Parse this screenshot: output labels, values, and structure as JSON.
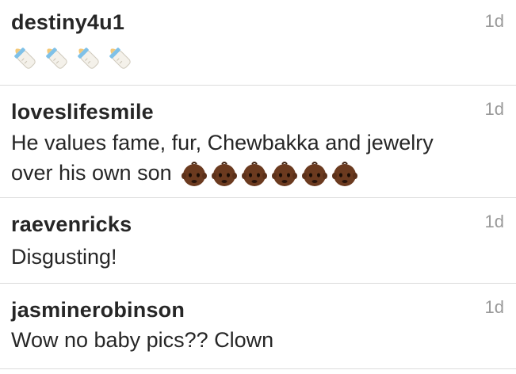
{
  "comments": [
    {
      "username": "destiny4u1",
      "time": "1d",
      "text": "",
      "emoji_name": "baby-bottle-icon",
      "emoji_count": 4
    },
    {
      "username": "loveslifesmile",
      "time": "1d",
      "text_line1": "He values fame, fur, Chewbakka and jewelry",
      "text_line2": "over his own son",
      "emoji_name": "baby-face-icon",
      "emoji_count": 6
    },
    {
      "username": "raevenricks",
      "time": "1d",
      "text": "Disgusting!"
    },
    {
      "username": "jasminerobinson",
      "time": "1d",
      "text": "Wow no baby pics?? Clown"
    }
  ],
  "colors": {
    "text": "#262626",
    "timestamp": "#999999",
    "divider": "#dbdbdb",
    "baby_skin": "#6b3a1f"
  }
}
